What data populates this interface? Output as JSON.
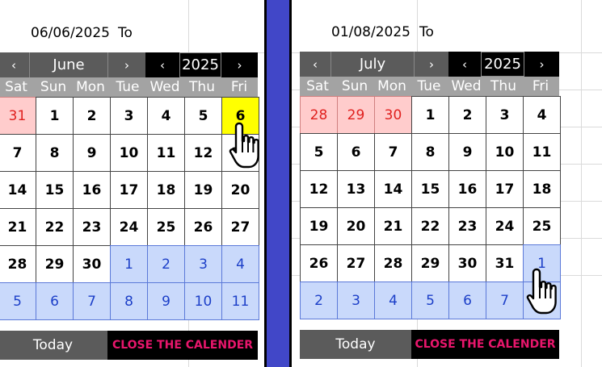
{
  "left": {
    "date_text": "06/06/2025",
    "to_label": "To",
    "month": "June",
    "year": "2025",
    "prev_arrow": "‹",
    "next_arrow": "›",
    "days_of_week": [
      "Sat",
      "Sun",
      "Mon",
      "Tue",
      "Wed",
      "Thu",
      "Fri"
    ],
    "weeks": [
      [
        {
          "d": "31",
          "t": "prev"
        },
        {
          "d": "1",
          "t": "cur"
        },
        {
          "d": "2",
          "t": "cur"
        },
        {
          "d": "3",
          "t": "cur"
        },
        {
          "d": "4",
          "t": "cur"
        },
        {
          "d": "5",
          "t": "cur"
        },
        {
          "d": "6",
          "t": "sel"
        }
      ],
      [
        {
          "d": "7",
          "t": "cur"
        },
        {
          "d": "8",
          "t": "cur"
        },
        {
          "d": "9",
          "t": "cur"
        },
        {
          "d": "10",
          "t": "cur"
        },
        {
          "d": "11",
          "t": "cur"
        },
        {
          "d": "12",
          "t": "cur"
        },
        {
          "d": "13",
          "t": "cur"
        }
      ],
      [
        {
          "d": "14",
          "t": "cur"
        },
        {
          "d": "15",
          "t": "cur"
        },
        {
          "d": "16",
          "t": "cur"
        },
        {
          "d": "17",
          "t": "cur"
        },
        {
          "d": "18",
          "t": "cur"
        },
        {
          "d": "19",
          "t": "cur"
        },
        {
          "d": "20",
          "t": "cur"
        }
      ],
      [
        {
          "d": "21",
          "t": "cur"
        },
        {
          "d": "22",
          "t": "cur"
        },
        {
          "d": "23",
          "t": "cur"
        },
        {
          "d": "24",
          "t": "cur"
        },
        {
          "d": "25",
          "t": "cur"
        },
        {
          "d": "26",
          "t": "cur"
        },
        {
          "d": "27",
          "t": "cur"
        }
      ],
      [
        {
          "d": "28",
          "t": "cur"
        },
        {
          "d": "29",
          "t": "cur"
        },
        {
          "d": "30",
          "t": "cur"
        },
        {
          "d": "1",
          "t": "next"
        },
        {
          "d": "2",
          "t": "next"
        },
        {
          "d": "3",
          "t": "next"
        },
        {
          "d": "4",
          "t": "next"
        }
      ],
      [
        {
          "d": "5",
          "t": "next"
        },
        {
          "d": "6",
          "t": "next"
        },
        {
          "d": "7",
          "t": "next"
        },
        {
          "d": "8",
          "t": "next"
        },
        {
          "d": "9",
          "t": "next"
        },
        {
          "d": "10",
          "t": "next"
        },
        {
          "d": "11",
          "t": "next"
        }
      ]
    ],
    "today_label": "Today",
    "close_label": "CLOSE THE CALENDER"
  },
  "right": {
    "date_text": "01/08/2025",
    "to_label": "To",
    "month": "July",
    "year": "2025",
    "prev_arrow": "‹",
    "next_arrow": "›",
    "days_of_week": [
      "Sat",
      "Sun",
      "Mon",
      "Tue",
      "Wed",
      "Thu",
      "Fri"
    ],
    "weeks": [
      [
        {
          "d": "28",
          "t": "prev"
        },
        {
          "d": "29",
          "t": "prev"
        },
        {
          "d": "30",
          "t": "prev"
        },
        {
          "d": "1",
          "t": "cur"
        },
        {
          "d": "2",
          "t": "cur"
        },
        {
          "d": "3",
          "t": "cur"
        },
        {
          "d": "4",
          "t": "cur"
        }
      ],
      [
        {
          "d": "5",
          "t": "cur"
        },
        {
          "d": "6",
          "t": "cur"
        },
        {
          "d": "7",
          "t": "cur"
        },
        {
          "d": "8",
          "t": "cur"
        },
        {
          "d": "9",
          "t": "cur"
        },
        {
          "d": "10",
          "t": "cur"
        },
        {
          "d": "11",
          "t": "cur"
        }
      ],
      [
        {
          "d": "12",
          "t": "cur"
        },
        {
          "d": "13",
          "t": "cur"
        },
        {
          "d": "14",
          "t": "cur"
        },
        {
          "d": "15",
          "t": "cur"
        },
        {
          "d": "16",
          "t": "cur"
        },
        {
          "d": "17",
          "t": "cur"
        },
        {
          "d": "18",
          "t": "cur"
        }
      ],
      [
        {
          "d": "19",
          "t": "cur"
        },
        {
          "d": "20",
          "t": "cur"
        },
        {
          "d": "21",
          "t": "cur"
        },
        {
          "d": "22",
          "t": "cur"
        },
        {
          "d": "23",
          "t": "cur"
        },
        {
          "d": "24",
          "t": "cur"
        },
        {
          "d": "25",
          "t": "cur"
        }
      ],
      [
        {
          "d": "26",
          "t": "cur"
        },
        {
          "d": "27",
          "t": "cur"
        },
        {
          "d": "28",
          "t": "cur"
        },
        {
          "d": "29",
          "t": "cur"
        },
        {
          "d": "30",
          "t": "cur"
        },
        {
          "d": "31",
          "t": "cur"
        },
        {
          "d": "1",
          "t": "next"
        }
      ],
      [
        {
          "d": "2",
          "t": "next"
        },
        {
          "d": "3",
          "t": "next"
        },
        {
          "d": "4",
          "t": "next"
        },
        {
          "d": "5",
          "t": "next"
        },
        {
          "d": "6",
          "t": "next"
        },
        {
          "d": "7",
          "t": "next"
        },
        {
          "d": "8",
          "t": "next"
        }
      ]
    ],
    "today_label": "Today",
    "close_label": "CLOSE THE CALENDER"
  },
  "colors": {
    "selected_day": "#ffff00",
    "prev_month_bg": "#ffcccc",
    "next_month_bg": "#c9d9fb",
    "close_text": "#e8166c",
    "divider": "#4147c8"
  },
  "icons": [
    "hand-pointer-icon"
  ]
}
